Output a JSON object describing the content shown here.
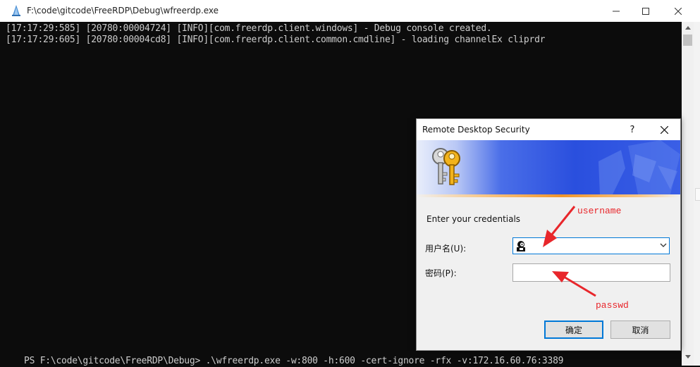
{
  "window": {
    "title": "F:\\code\\gitcode\\FreeRDP\\Debug\\wfreerdp.exe",
    "icon": "freerdp-app-icon",
    "controls": [
      "minimize-icon",
      "maximize-icon",
      "close-icon"
    ]
  },
  "console": {
    "lines": [
      "[17:17:29:585] [20780:00004724] [INFO][com.freerdp.client.windows] - Debug console created.",
      "[17:17:29:605] [20780:00004cd8] [INFO][com.freerdp.client.common.cmdline] - loading channelEx cliprdr"
    ],
    "partial_command": "PS F:\\code\\gitcode\\FreeRDP\\Debug> .\\wfreerdp.exe -w:800 -h:600 -cert-ignore -rfx -v:172.16.60.76:3389"
  },
  "dialog": {
    "title": "Remote Desktop Security",
    "help": "?",
    "prompt": "Enter your credentials",
    "username_label": "用户名(U):",
    "password_label": "密码(P):",
    "username_value": "",
    "password_value": "",
    "ok_label": "确定",
    "cancel_label": "取消"
  },
  "annotations": {
    "username": "username",
    "passwd": "passwd",
    "color": "#e8262b"
  },
  "colors": {
    "console_bg": "#0c0c0c",
    "console_text": "#cccccc",
    "accent": "#0078d7"
  }
}
